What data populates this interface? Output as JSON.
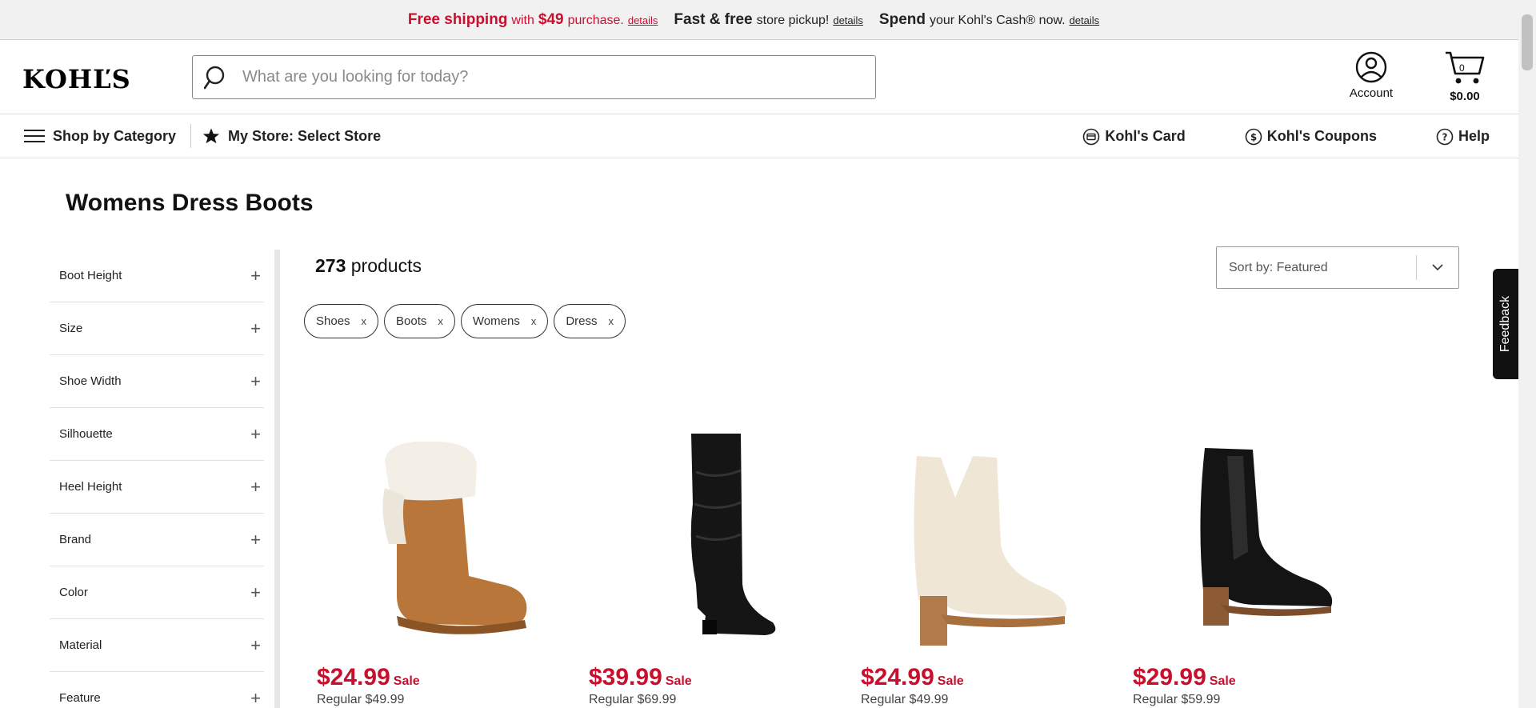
{
  "promo": {
    "free_shipping": "Free shipping",
    "with": "with",
    "amount": "$49",
    "purchase": "purchase.",
    "details1": "details",
    "fast_free": "Fast & free",
    "store_pickup": "store pickup!",
    "details2": "details",
    "spend": "Spend",
    "kohls_cash": "your Kohl's Cash® now.",
    "details3": "details"
  },
  "header": {
    "logo": "KOHĽS",
    "search_placeholder": "What are you looking for today?",
    "account_label": "Account",
    "cart_count": "0",
    "cart_total": "$0.00"
  },
  "nav": {
    "shop_by_category": "Shop by Category",
    "my_store": "My Store: Select Store",
    "kohls_card": "Kohl's Card",
    "kohls_coupons": "Kohl's Coupons",
    "help": "Help"
  },
  "page_title": "Womens Dress Boots",
  "filters": [
    "Boot Height",
    "Size",
    "Shoe Width",
    "Silhouette",
    "Heel Height",
    "Brand",
    "Color",
    "Material",
    "Feature"
  ],
  "results": {
    "count": "273",
    "count_label": "products",
    "sort_label": "Sort by: Featured"
  },
  "chips": [
    {
      "label": "Shoes"
    },
    {
      "label": "Boots"
    },
    {
      "label": "Womens"
    },
    {
      "label": "Dress"
    }
  ],
  "chip_remove": "x",
  "products": [
    {
      "price": "$24.99",
      "sale": "Sale",
      "regular": "Regular $49.99",
      "image": "shearling-cuff-boot"
    },
    {
      "price": "$39.99",
      "sale": "Sale",
      "regular": "Regular $69.99",
      "image": "black-slouch-tall-boot"
    },
    {
      "price": "$24.99",
      "sale": "Sale",
      "regular": "Regular $49.99",
      "image": "cream-ankle-bootie"
    },
    {
      "price": "$29.99",
      "sale": "Sale",
      "regular": "Regular $59.99",
      "image": "black-chelsea-bootie"
    }
  ],
  "feedback": "Feedback",
  "colors": {
    "brand_red": "#c8102e",
    "text": "#222222"
  }
}
